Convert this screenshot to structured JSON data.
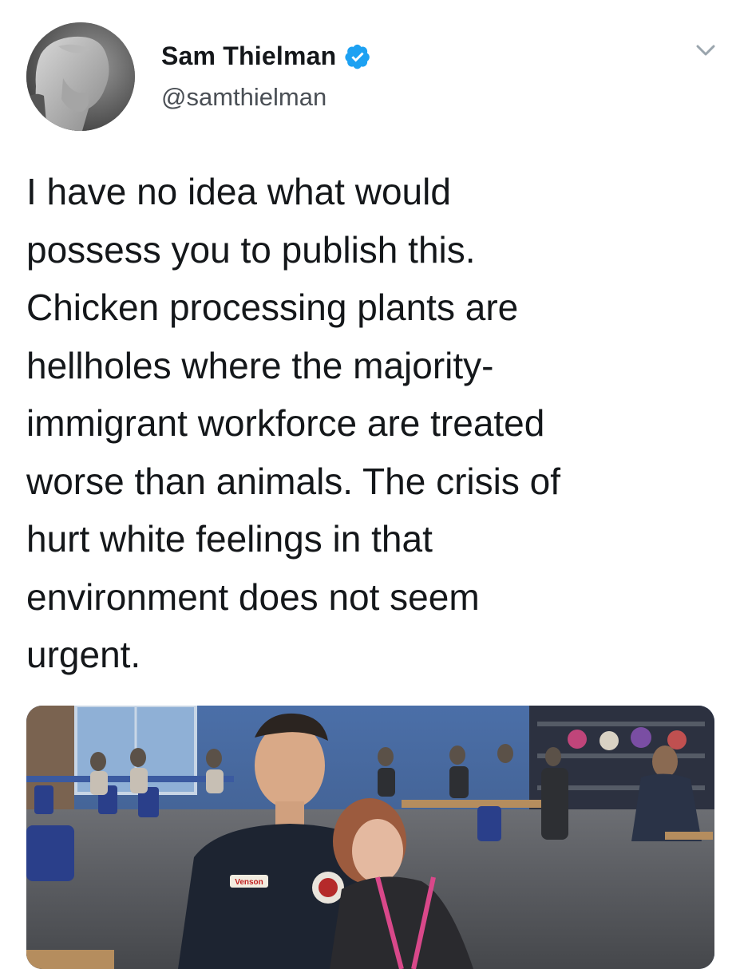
{
  "tweet": {
    "author": {
      "display_name": "Sam Thielman",
      "handle": "@samthielman",
      "verified": true
    },
    "text": "I have no idea what would\npossess you to publish this.\nChicken processing plants are\nhellholes where the majority-\nimmigrant workforce are treated\nworse than animals. The crisis of\nhurt white feelings in that\nenvironment does not seem\nurgent.",
    "media": {
      "name_tag": "Venson"
    }
  },
  "colors": {
    "verified_blue": "#1da1f2",
    "text": "#14171a",
    "secondary_text": "#4a4f55"
  },
  "icons": {
    "verified": "verified-badge-icon",
    "menu": "chevron-down-icon"
  }
}
